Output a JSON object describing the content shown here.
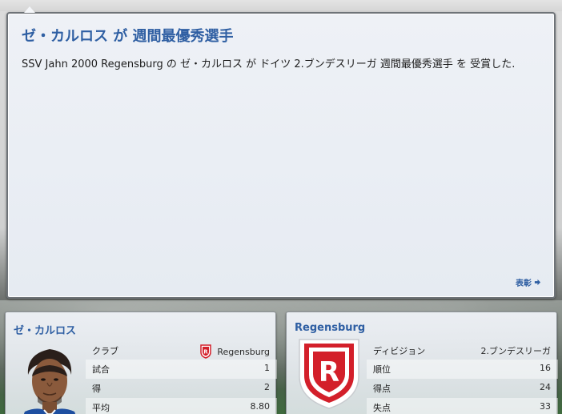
{
  "news": {
    "title": "ゼ・カルロス が 週間最優秀選手",
    "body": "SSV Jahn 2000 Regensburg の ゼ・カルロス が ドイツ 2.ブンデスリーガ 週間最優秀選手 を 受賞した.",
    "footer_link": "表彰",
    "footer_icon": "arrow-right-icon"
  },
  "player_card": {
    "name": "ゼ・カルロス",
    "stats": [
      {
        "label": "クラブ",
        "value": "Regensburg"
      },
      {
        "label": "試合",
        "value": "1"
      },
      {
        "label": "得",
        "value": "2"
      },
      {
        "label": "平均",
        "value": "8.80"
      }
    ]
  },
  "club_card": {
    "name": "Regensburg",
    "crest_letter": "R",
    "stats": [
      {
        "label": "ディビジョン",
        "value": "2.ブンデスリーガ"
      },
      {
        "label": "順位",
        "value": "16"
      },
      {
        "label": "得点",
        "value": "24"
      },
      {
        "label": "失点",
        "value": "33"
      }
    ]
  },
  "colors": {
    "accent": "#2f5fa3",
    "crest_red": "#d31f2a"
  }
}
